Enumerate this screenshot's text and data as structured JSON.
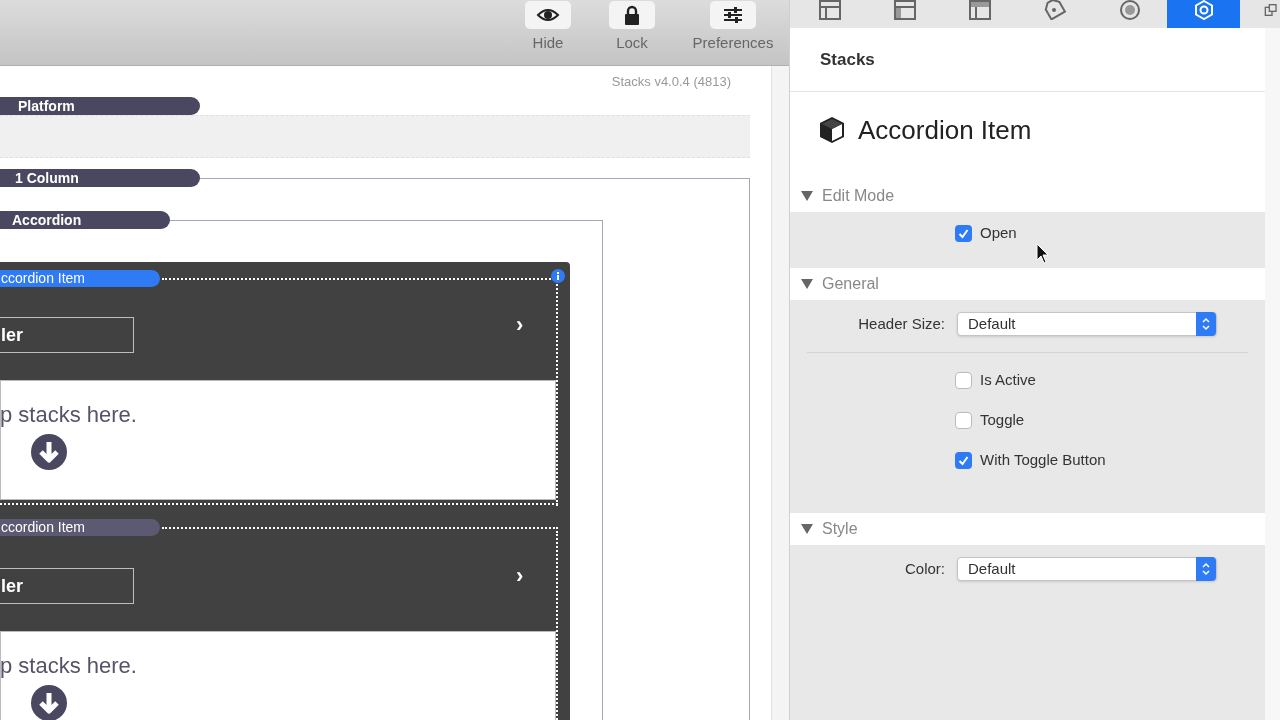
{
  "toolbar": {
    "buttons": [
      {
        "label": "Hide",
        "kind": "eye"
      },
      {
        "label": "Lock",
        "kind": "lock"
      },
      {
        "label": "Preferences",
        "kind": "sliders"
      }
    ]
  },
  "canvas": {
    "version": "Stacks v4.0.4 (4813)",
    "platform": {
      "label": "Platform"
    },
    "column": {
      "label": "1 Column"
    },
    "accordion": {
      "label": "Accordion"
    },
    "items": [
      {
        "label": "ccordion Item",
        "selected": true,
        "header": "ler",
        "chevron": "›",
        "drop_text": "p stacks here."
      },
      {
        "label": "ccordion Item",
        "selected": false,
        "header": "ler",
        "chevron": "›",
        "drop_text": "p stacks here."
      }
    ]
  },
  "inspector": {
    "tabs": [
      {
        "kind": "layout-left",
        "selected": false
      },
      {
        "kind": "layout-sidebar",
        "selected": false
      },
      {
        "kind": "layout-top",
        "selected": false
      },
      {
        "kind": "tag",
        "selected": false
      },
      {
        "kind": "circle",
        "selected": false
      },
      {
        "kind": "gear",
        "selected": true
      },
      {
        "kind": "windows",
        "selected": false
      }
    ],
    "panel_title": "Stacks",
    "stack_title": "Accordion Item",
    "sections": [
      {
        "title": "Edit Mode",
        "expanded": true,
        "rows": [
          {
            "kind": "checkbox",
            "label": "Open",
            "checked": true
          }
        ]
      },
      {
        "title": "General",
        "expanded": true,
        "rows": [
          {
            "kind": "select",
            "label": "Header Size:",
            "value": "Default"
          },
          {
            "kind": "divider"
          },
          {
            "kind": "checkbox",
            "label": "Is Active",
            "checked": false
          },
          {
            "kind": "checkbox",
            "label": "Toggle",
            "checked": false
          },
          {
            "kind": "checkbox",
            "label": "With Toggle Button",
            "checked": true
          }
        ]
      },
      {
        "title": "Style",
        "expanded": true,
        "rows": [
          {
            "kind": "select",
            "label": "Color:",
            "value": "Default"
          }
        ]
      }
    ]
  }
}
